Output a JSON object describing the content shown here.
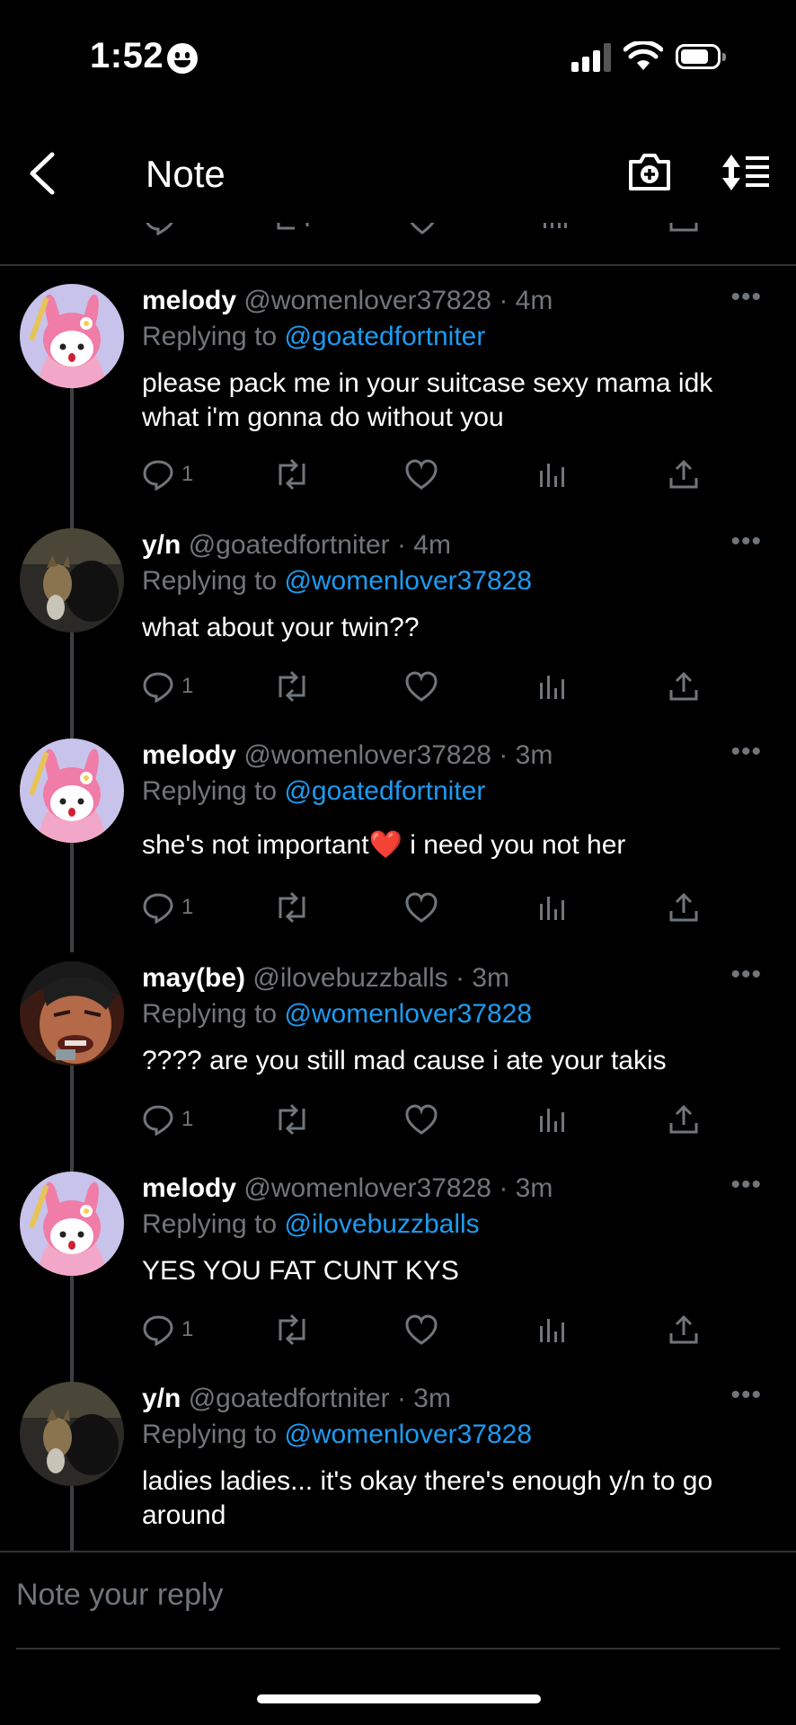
{
  "status_bar": {
    "time": "1:52"
  },
  "header": {
    "title": "Note"
  },
  "tweets": [
    {
      "name": "melody",
      "handle": "@womenlover37828",
      "time": "· 4m",
      "replying_prefix": "Replying to ",
      "replying_to": "@goatedfortniter",
      "text": "please pack me in your suitcase sexy mama idk what i'm gonna do without you",
      "reply_count": "1",
      "avatar": "melody-avatar"
    },
    {
      "name": "y/n",
      "handle": "@goatedfortniter",
      "time": "· 4m",
      "replying_prefix": "Replying to ",
      "replying_to": "@womenlover37828",
      "text": "what about your twin??",
      "reply_count": "1",
      "avatar": "yn-avatar"
    },
    {
      "name": "melody",
      "handle": "@womenlover37828",
      "time": "· 3m",
      "replying_prefix": "Replying to ",
      "replying_to": "@goatedfortniter",
      "text": "she's not important❤️  i need you not her",
      "reply_count": "1",
      "avatar": "melody-avatar"
    },
    {
      "name": "may(be)",
      "handle": "@ilovebuzzballs",
      "time": "· 3m",
      "replying_prefix": "Replying to ",
      "replying_to": "@womenlover37828",
      "text": "???? are you still mad cause i ate your takis",
      "reply_count": "1",
      "avatar": "maybe-avatar"
    },
    {
      "name": "melody",
      "handle": "@womenlover37828",
      "time": "· 3m",
      "replying_prefix": "Replying to ",
      "replying_to": "@ilovebuzzballs",
      "text": "YES YOU FAT CUNT KYS",
      "reply_count": "1",
      "avatar": "melody-avatar"
    },
    {
      "name": "y/n",
      "handle": "@goatedfortniter",
      "time": "· 3m",
      "replying_prefix": "Replying to ",
      "replying_to": "@womenlover37828",
      "text": "ladies ladies... it's okay there's enough y/n to go around",
      "reply_count": "",
      "avatar": "yn-avatar"
    }
  ],
  "reply_box": {
    "placeholder": "Note your reply"
  },
  "colors": {
    "background": "#000000",
    "accent": "#1d9bf0",
    "muted": "#71767b",
    "text": "#ffffff"
  }
}
